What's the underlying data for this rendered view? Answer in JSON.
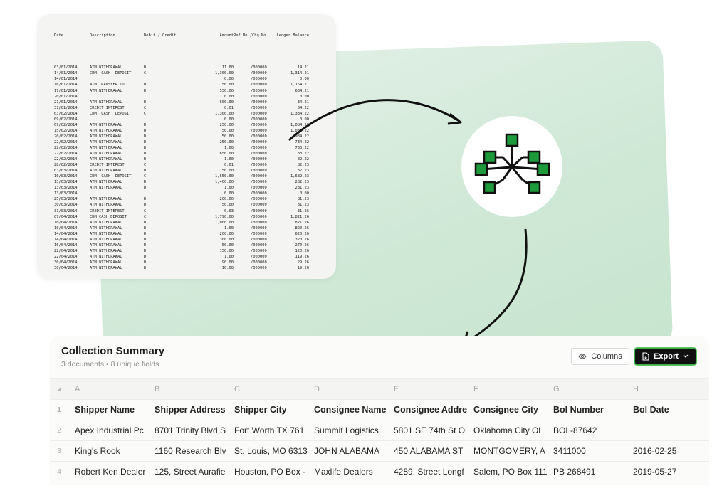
{
  "ledger": {
    "headers": [
      "Date",
      "Description",
      "Debit / Credit",
      "Amount",
      "Ref.No./Chq.No.",
      "",
      "Ledger Balance"
    ],
    "rows": [
      [
        "03/01/2014",
        "ATM WITHDRAWAL",
        "D",
        "11.00",
        "/000000",
        "14.21"
      ],
      [
        "14/01/2014",
        "CDM  CASH  DEPOSIT",
        "C",
        "1,300.00",
        "/000000",
        "1,314.21"
      ],
      [
        "14/01/2014",
        "",
        "",
        "0.00",
        "/000000",
        "0.00"
      ],
      [
        "16/01/2014",
        "ATM TRANSFER TO",
        "D",
        "150.00",
        "/000000",
        "1,164.21"
      ],
      [
        "17/01/2014",
        "ATM WITHDRAWAL",
        "D",
        "530.00",
        "/000000",
        "634.21"
      ],
      [
        "20/01/2014",
        "",
        "",
        "0.00",
        "/000000",
        "0.00"
      ],
      [
        "21/01/2014",
        "ATM WITHDRAWAL",
        "D",
        "600.00",
        "/000000",
        "34.21"
      ],
      [
        "31/01/2014",
        "CREDIT INTEREST",
        "C",
        "0.01",
        "/000000",
        "34.22"
      ],
      [
        "03/02/2014",
        "CDM  CASH  DEPOSIT",
        "C",
        "1,300.00",
        "/000000",
        "1,334.22"
      ],
      [
        "09/02/2014",
        "",
        "",
        "0.00",
        "/000000",
        "0.00"
      ],
      [
        "09/02/2014",
        "ATM WITHDRAWAL",
        "D",
        "250.00",
        "/000000",
        "1,084.22"
      ],
      [
        "15/02/2014",
        "ATM WITHDRAWAL",
        "D",
        "50.00",
        "/000000",
        "1,034.22"
      ],
      [
        "20/02/2014",
        "ATM WITHDRAWAL",
        "D",
        "50.00",
        "/000000",
        "984.22"
      ],
      [
        "22/02/2014",
        "ATM WITHDRAWAL",
        "D",
        "250.00",
        "/000000",
        "734.22"
      ],
      [
        "22/02/2014",
        "ATM WITHDRAWAL",
        "D",
        "1.00",
        "/000000",
        "733.22"
      ],
      [
        "22/02/2014",
        "ATM WITHDRAWAL",
        "D",
        "650.00",
        "/000000",
        "83.22"
      ],
      [
        "22/02/2014",
        "ATM WITHDRAWAL",
        "D",
        "1.00",
        "/000000",
        "82.22"
      ],
      [
        "28/02/2014",
        "CREDIT INTEREST",
        "C",
        "0.01",
        "/000000",
        "82.23"
      ],
      [
        "03/03/2014",
        "ATM WITHDRAWAL",
        "D",
        "50.00",
        "/000000",
        "32.23"
      ],
      [
        "10/03/2014",
        "CDM  CASH  DEPOSIT",
        "C",
        "1,650.00",
        "/000000",
        "1,682.23"
      ],
      [
        "13/03/2014",
        "ATM WITHDRAWAL",
        "D",
        "1,400.00",
        "/000000",
        "282.23"
      ],
      [
        "13/03/2014",
        "ATM WITHDRAWAL",
        "D",
        "1.00",
        "/000000",
        "281.23"
      ],
      [
        "13/03/2014",
        "",
        "",
        "0.00",
        "/000000",
        "0.00"
      ],
      [
        "25/03/2014",
        "ATM WITHDRAWAL",
        "D",
        "200.00",
        "/000000",
        "81.23"
      ],
      [
        "30/03/2014",
        "ATM WITHDRAWAL",
        "D",
        "50.00",
        "/000000",
        "31.23"
      ],
      [
        "31/03/2014",
        "CREDIT INTEREST",
        "C",
        "0.03",
        "/000000",
        "31.26"
      ],
      [
        "07/04/2014",
        "CDM CASH DEPOSIT",
        "C",
        "1,790.00",
        "/000000",
        "1,821.26"
      ],
      [
        "10/04/2014",
        "ATM WITHDRAWAL",
        "D",
        "1,000.00",
        "/000000",
        "821.26"
      ],
      [
        "10/04/2014",
        "ATM WITHDRAWAL",
        "D",
        "1.00",
        "/000000",
        "820.26"
      ],
      [
        "14/04/2014",
        "ATM WITHDRAWAL",
        "D",
        "200.00",
        "/000000",
        "620.26"
      ],
      [
        "14/04/2014",
        "ATM WITHDRAWAL",
        "D",
        "300.00",
        "/000000",
        "320.26"
      ],
      [
        "16/04/2014",
        "ATM WITHDRAWAL",
        "D",
        "50.00",
        "/000000",
        "270.26"
      ],
      [
        "22/04/2014",
        "ATM WITHDRAWAL",
        "D",
        "150.00",
        "/000000",
        "120.26"
      ],
      [
        "22/04/2014",
        "ATM WITHDRAWAL",
        "D",
        "1.00",
        "/000000",
        "119.26"
      ],
      [
        "30/04/2014",
        "ATM WITHDRAWAL",
        "D",
        "90.00",
        "/000000",
        "29.26"
      ],
      [
        "30/04/2014",
        "ATM WITHDRAWAL",
        "D",
        "10.00",
        "/000000",
        "19.26"
      ]
    ]
  },
  "hub_icon": "data-hub-icon",
  "summary": {
    "title": "Collection Summary",
    "subtitle": "3 documents • 8 unique fields",
    "columns_button": "Columns",
    "export_button": "Export",
    "column_letters": [
      "A",
      "B",
      "C",
      "D",
      "E",
      "F",
      "G",
      "H"
    ],
    "row_numbers": [
      "1",
      "2",
      "3",
      "4"
    ],
    "headers": [
      "Shipper Name",
      "Shipper Address",
      "Shipper City",
      "Consignee Name",
      "Consignee Addre",
      "Consignee City",
      "Bol Number",
      "Bol Date"
    ],
    "rows": [
      [
        "Apex Industrial Pc",
        "8701 Trinity Blvd S",
        "Fort Worth TX 761",
        "Summit Logistics",
        "5801 SE 74th St Ol",
        "Oklahoma City Ol",
        "BOL-87642",
        ""
      ],
      [
        "King's Rook",
        "1160 Research Blv",
        "St. Louis, MO 6313",
        "JOHN ALABAMA",
        "450 ALABAMA ST",
        "MONTGOMERY, A",
        "3411000",
        "2016-02-25"
      ],
      [
        "Robert Ken Dealer",
        "125, Street Aurafie",
        "Houston, PO Box ·",
        "Maxlife Dealers",
        "4289, Street Longf",
        "Salem, PO Box 111",
        "PB 268491",
        "2019-05-27"
      ]
    ]
  },
  "colors": {
    "accent": "#3cb043",
    "hub_node": "#1f9a3a",
    "export_bg": "#111111"
  }
}
